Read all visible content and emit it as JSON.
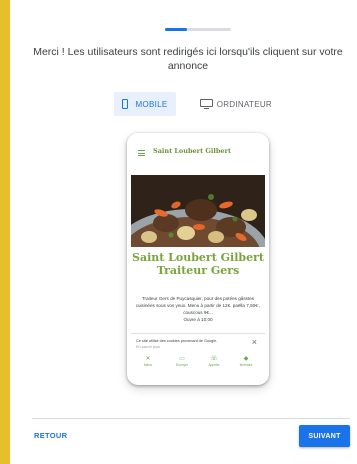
{
  "wizard": {
    "progress_fraction": 0.33,
    "message": "Merci ! Les utilisateurs sont redirigés ici lorsqu'ils cliquent sur votre annonce",
    "toggle": {
      "mobile_label": "MOBILE",
      "desktop_label": "ORDINATEUR",
      "selected": "mobile"
    },
    "footer": {
      "back_label": "RETOUR",
      "next_label": "SUIVANT"
    }
  },
  "preview": {
    "header_title": "Saint Loubert Gilbert",
    "restaurant_name": "Saint Loubert Gilbert Traiteur Gers",
    "description": "Traiteur Gers de Puycasquier, pour des potées gâsstes cuisinées sous vos yeux. Menu à partir de 12€, paëlla 7,50€ , couscous 9€...",
    "hours": "Ouvre à 10:00",
    "cookie_text": "Ce site utilise des cookies provenant de Google.",
    "cookie_link": "En savoir plus",
    "nav": [
      {
        "icon": "restaurant-icon",
        "label": "Menu"
      },
      {
        "icon": "message-icon",
        "label": "Envoyer"
      },
      {
        "icon": "phone-icon",
        "label": "Appeler"
      },
      {
        "icon": "directions-icon",
        "label": "Itinéraire"
      }
    ]
  },
  "colors": {
    "accent": "#1a73e8",
    "brand_green": "#7aa33c",
    "frame": "#e5c02b"
  }
}
